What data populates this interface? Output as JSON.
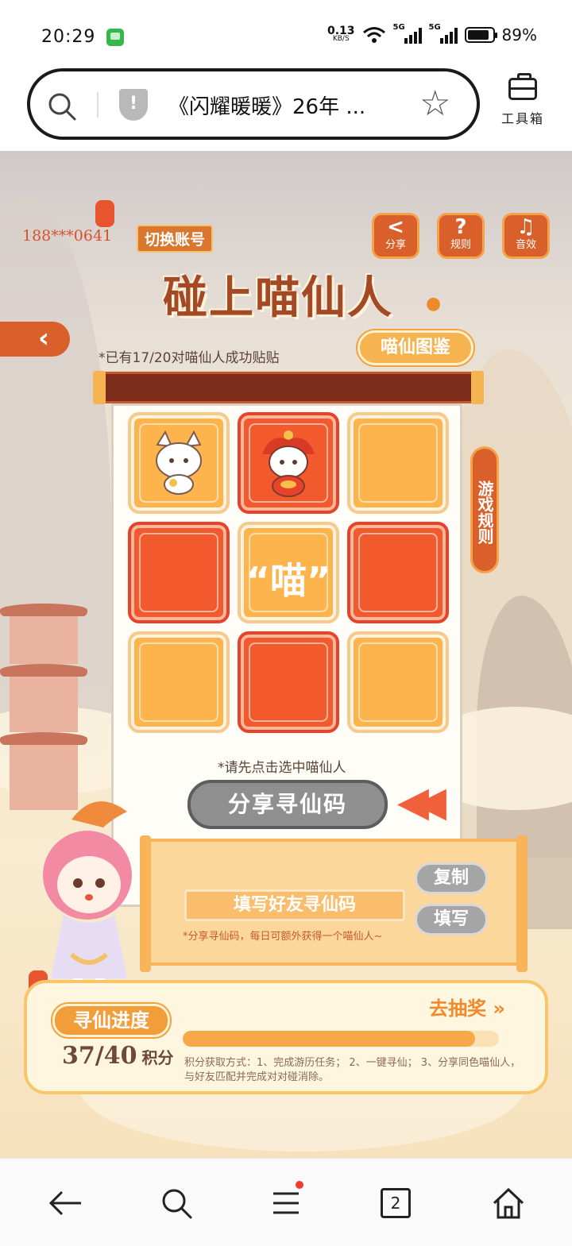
{
  "status": {
    "time": "20:29",
    "net_speed_value": "0.13",
    "net_speed_unit": "KB/S",
    "signal1_label": "5G",
    "signal2_label": "5G",
    "battery": "89%"
  },
  "browser": {
    "title": "《闪耀暖暖》26年 ...",
    "toolbox_label": "工具箱"
  },
  "game": {
    "account_id": "188***0641",
    "switch_account": "切换账号",
    "share_label": "分享",
    "rules_label": "规则",
    "sound_label": "音效",
    "title": "碰上喵仙人",
    "pairs_text": "*已有17/20对喵仙人成功贴贴",
    "codex_button": "喵仙图鉴",
    "side_rules": "游戏规则",
    "tiles": [
      {
        "color": "orange",
        "content": "char-white-cat"
      },
      {
        "color": "red",
        "content": "char-red-cat"
      },
      {
        "color": "orange",
        "content": ""
      },
      {
        "color": "red",
        "content": ""
      },
      {
        "color": "orange",
        "content": "meow"
      },
      {
        "color": "red",
        "content": ""
      },
      {
        "color": "orange",
        "content": ""
      },
      {
        "color": "red",
        "content": ""
      },
      {
        "color": "orange",
        "content": ""
      }
    ],
    "meow_text": "“喵”",
    "hint": "*请先点击选中喵仙人",
    "share_code_button": "分享寻仙码",
    "copy_button": "复制",
    "fill_button": "填写",
    "friend_code_placeholder": "填写好友寻仙码",
    "code_note": "*分享寻仙码，每日可额外获得一个喵仙人~",
    "progress_label": "寻仙进度",
    "progress_current": "37",
    "progress_total": "40",
    "progress_unit": "积分",
    "progress_fraction": 0.925,
    "lottery_link": "去抽奖 »",
    "progress_note": "积分获取方式：1、完成游历任务； 2、一键寻仙； 3、分享同色喵仙人，与好友匹配并完成对对碰消除。"
  },
  "bottom_nav": {
    "tab_count": "2"
  },
  "colors": {
    "accent_orange": "#fdb44d",
    "accent_red": "#f25a2e",
    "title_brown": "#a44925"
  }
}
